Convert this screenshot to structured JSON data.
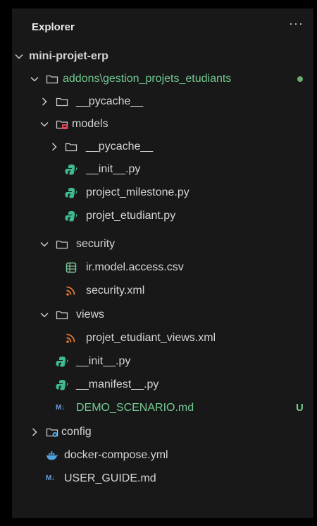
{
  "header": {
    "title": "Explorer",
    "more": "···"
  },
  "tree": {
    "root": "mini-projet-erp",
    "addons": {
      "prefix": "addons",
      "separator": "\\",
      "name": "gestion_projets_etudiants"
    },
    "pycache_top": "__pycache__",
    "models": "models",
    "models_pycache": "__pycache__",
    "init_models": "__init__.py",
    "project_milestone": "project_milestone.py",
    "projet_etudiant": "projet_etudiant.py",
    "security": "security",
    "access_csv": "ir.model.access.csv",
    "security_xml": "security.xml",
    "views": "views",
    "views_xml": "projet_etudiant_views.xml",
    "init_root": "__init__.py",
    "manifest": "__manifest__.py",
    "demo": "DEMO_SCENARIO.md",
    "demo_badge": "U",
    "config": "config",
    "docker": "docker-compose.yml",
    "user_guide": "USER_GUIDE.md",
    "md_icon": "M↓"
  },
  "colors": {
    "background": "#181818",
    "untracked_green": "#73c991",
    "python_green": "#3fb98f",
    "rss_orange": "#e37933",
    "markdown_blue": "#6d9ede",
    "docker_blue": "#4fa3e0"
  },
  "icons": [
    "chevron-down-icon",
    "chevron-right-icon",
    "folder-icon",
    "models-folder-icon",
    "config-folder-icon",
    "python-icon",
    "csv-icon",
    "rss-icon",
    "markdown-icon",
    "docker-icon"
  ]
}
